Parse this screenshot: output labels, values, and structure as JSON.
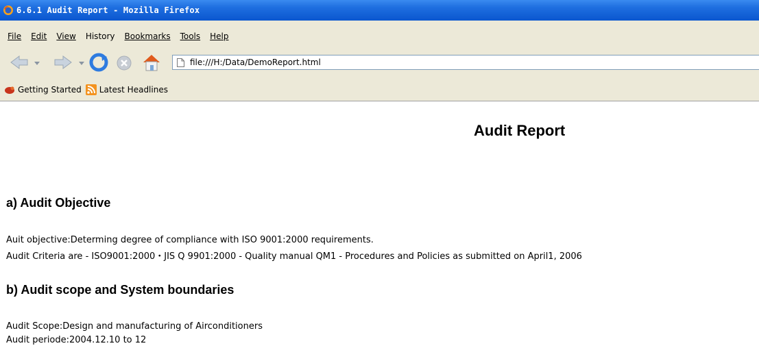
{
  "window": {
    "title": "6.6.1 Audit Report - Mozilla Firefox"
  },
  "menu": {
    "items": [
      "File",
      "Edit",
      "View",
      "History",
      "Bookmarks",
      "Tools",
      "Help"
    ],
    "accelerators": [
      "F",
      "E",
      "V",
      "s",
      "B",
      "T",
      "H"
    ]
  },
  "nav": {
    "url": "file:///H:/Data/DemoReport.html"
  },
  "bookmarks": {
    "items": [
      "Getting Started",
      "Latest Headlines"
    ]
  },
  "report": {
    "title": "Audit Report",
    "section_a": {
      "heading": "a) Audit Objective",
      "line1": "Auit objective:Determing degree of compliance with ISO 9001:2000 requirements.",
      "line2": "Audit Criteria are - ISO9001:2000・JIS Q 9901:2000 - Quality manual QM1 - Procedures and Policies as submitted on April1, 2006"
    },
    "section_b": {
      "heading": "b) Audit scope and System boundaries",
      "line1": "Audit Scope:Design and manufacturing of Airconditioners",
      "line2": "Audit periode:2004.12.10 to 12"
    }
  },
  "colors": {
    "titlebar": "#0a56cf",
    "chrome": "#ece9d8",
    "url_border": "#7f9db9"
  }
}
